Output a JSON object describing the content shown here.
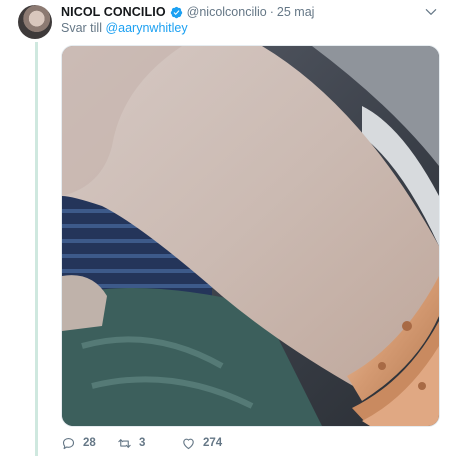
{
  "tweet": {
    "author_name": "NICOL CONCILIO",
    "handle": "@nicolconcilio",
    "separator": "·",
    "date": "25 maj",
    "reply_prefix": "Svar till",
    "reply_mention": "@aarynwhitley",
    "image_alt": "Photo of a forearm wearing gold bracelets",
    "counts": {
      "replies": "28",
      "retweets": "3",
      "likes": "274"
    }
  },
  "icons": {
    "avatar": "profile-avatar",
    "verified": "verified-badge-icon",
    "caret": "chevron-down-icon",
    "reply": "reply-icon",
    "retweet": "retweet-icon",
    "like": "heart-icon"
  },
  "colors": {
    "accent": "#1da1f2",
    "muted": "#657786",
    "thread_line": "#cfe8df"
  }
}
